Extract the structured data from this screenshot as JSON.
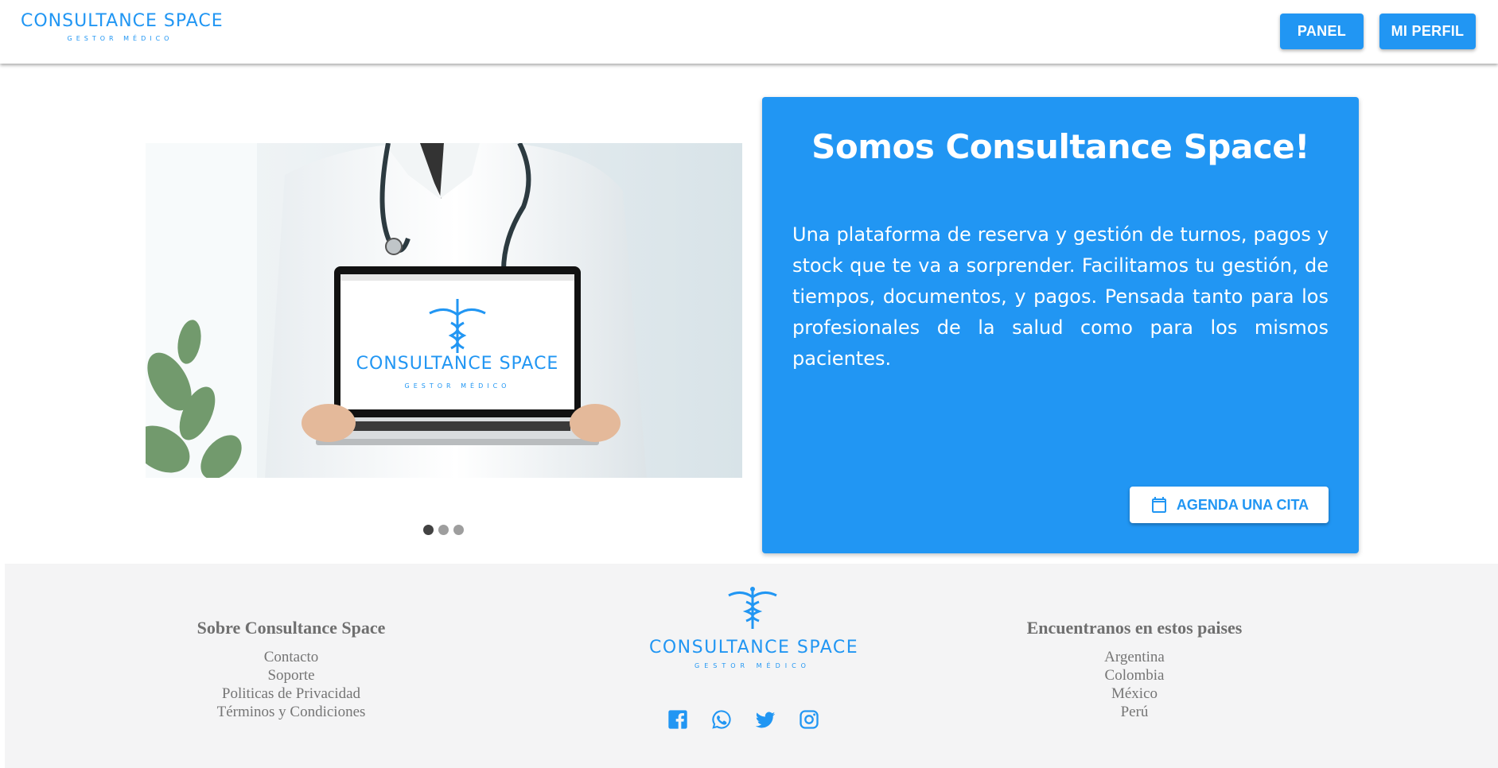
{
  "header": {
    "logo_brand": "CONSULTANCE SPACE",
    "logo_tagline": "GESTOR MÉDICO",
    "panel_label": "PANEL",
    "profile_label": "MI PERFIL"
  },
  "carousel": {
    "slide_logo_brand": "CONSULTANCE SPACE",
    "slide_logo_tagline": "GESTOR MÉDICO",
    "slide_count": 3,
    "active_slide": 1
  },
  "card": {
    "title": "Somos Consultance Space!",
    "description": "Una plataforma de reserva y gestión de turnos, pagos y stock que te va a sorprender. Facilitamos tu gestión, de tiempos, documentos, y pagos. Pensada tanto para los profesionales de la salud como para los mismos pacientes.",
    "cta_label": "AGENDA UNA CITA",
    "cta_icon": "calendar-icon"
  },
  "footer": {
    "about": {
      "title": "Sobre Consultance Space",
      "links": [
        "Contacto",
        "Soporte",
        "Politicas de Privacidad",
        "Términos y Condiciones"
      ]
    },
    "logo_brand": "CONSULTANCE SPACE",
    "logo_tagline": "GESTOR MÉDICO",
    "social_icons": [
      "facebook-icon",
      "whatsapp-icon",
      "twitter-icon",
      "instagram-icon"
    ],
    "countries": {
      "title": "Encuentranos en estos paises",
      "items": [
        "Argentina",
        "Colombia",
        "México",
        "Perú"
      ]
    }
  },
  "colors": {
    "accent": "#2196f3",
    "footer_bg": "#f4f4f5",
    "footer_text": "#757575"
  }
}
